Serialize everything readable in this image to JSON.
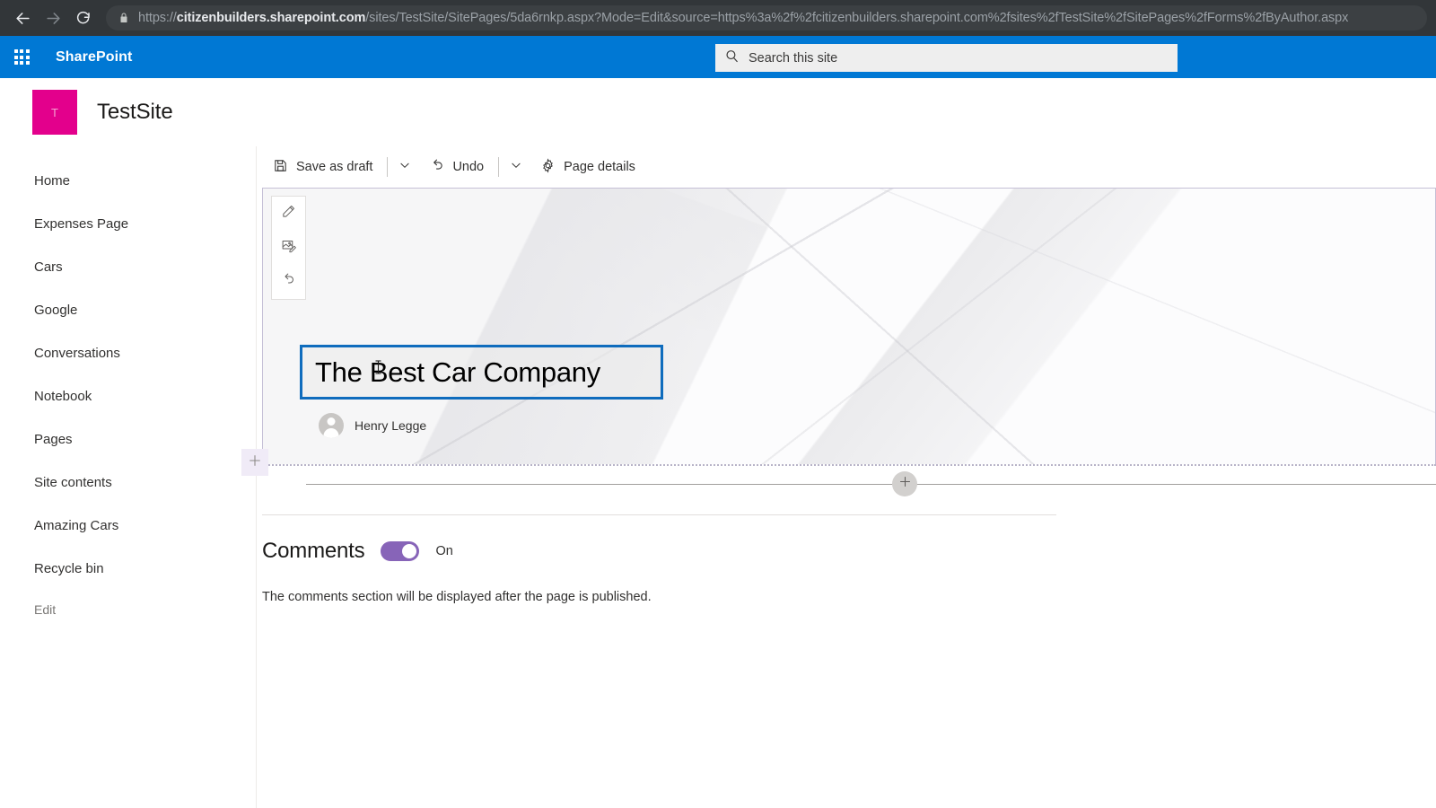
{
  "browser": {
    "back_icon": "back-arrow-icon",
    "forward_icon": "forward-arrow-icon",
    "reload_icon": "reload-icon",
    "lock_icon": "lock-icon",
    "url_scheme": "https://",
    "url_host": "citizenbuilders.sharepoint.com",
    "url_path": "/sites/TestSite/SitePages/5da6rnkp.aspx?Mode=Edit&source=https%3a%2f%2fcitizenbuilders.sharepoint.com%2fsites%2fTestSite%2fSitePages%2fForms%2fByAuthor.aspx"
  },
  "suite": {
    "waffle_icon": "app-launcher-waffle-icon",
    "brand": "SharePoint",
    "search_icon": "search-icon",
    "search_placeholder": "Search this site",
    "search_value": "",
    "accent_color": "#0078d4"
  },
  "site": {
    "logo_letter": "T",
    "logo_color": "#e3008c",
    "title": "TestSite"
  },
  "sidebar": {
    "items": [
      {
        "label": "Home"
      },
      {
        "label": "Expenses Page"
      },
      {
        "label": "Cars"
      },
      {
        "label": "Google"
      },
      {
        "label": "Conversations"
      },
      {
        "label": "Notebook"
      },
      {
        "label": "Pages"
      },
      {
        "label": "Site contents"
      },
      {
        "label": "Amazing Cars"
      },
      {
        "label": "Recycle bin"
      }
    ],
    "edit_label": "Edit"
  },
  "command_bar": {
    "save_icon": "save-disk-icon",
    "save_label": "Save as draft",
    "save_chevron_icon": "chevron-down-icon",
    "undo_icon": "undo-arrow-icon",
    "undo_label": "Undo",
    "undo_chevron_icon": "chevron-down-icon",
    "page_details_icon": "gear-icon",
    "page_details_label": "Page details"
  },
  "hero": {
    "tools": [
      {
        "icon": "pencil-edit-icon"
      },
      {
        "icon": "change-image-icon"
      },
      {
        "icon": "revert-undo-icon"
      }
    ],
    "title_value": "The Best Car Company",
    "title_focus_color": "#0f6cbd",
    "author_avatar_icon": "person-avatar-icon",
    "author_name": "Henry Legge",
    "text_caret_icon": "text-cursor-icon"
  },
  "section": {
    "add_section_icon": "plus-icon",
    "add_webpart_icon": "plus-icon"
  },
  "comments": {
    "title": "Comments",
    "toggle_state_label": "On",
    "toggle_on": true,
    "toggle_color": "#8764b8",
    "note": "The comments section will be displayed after the page is published."
  }
}
